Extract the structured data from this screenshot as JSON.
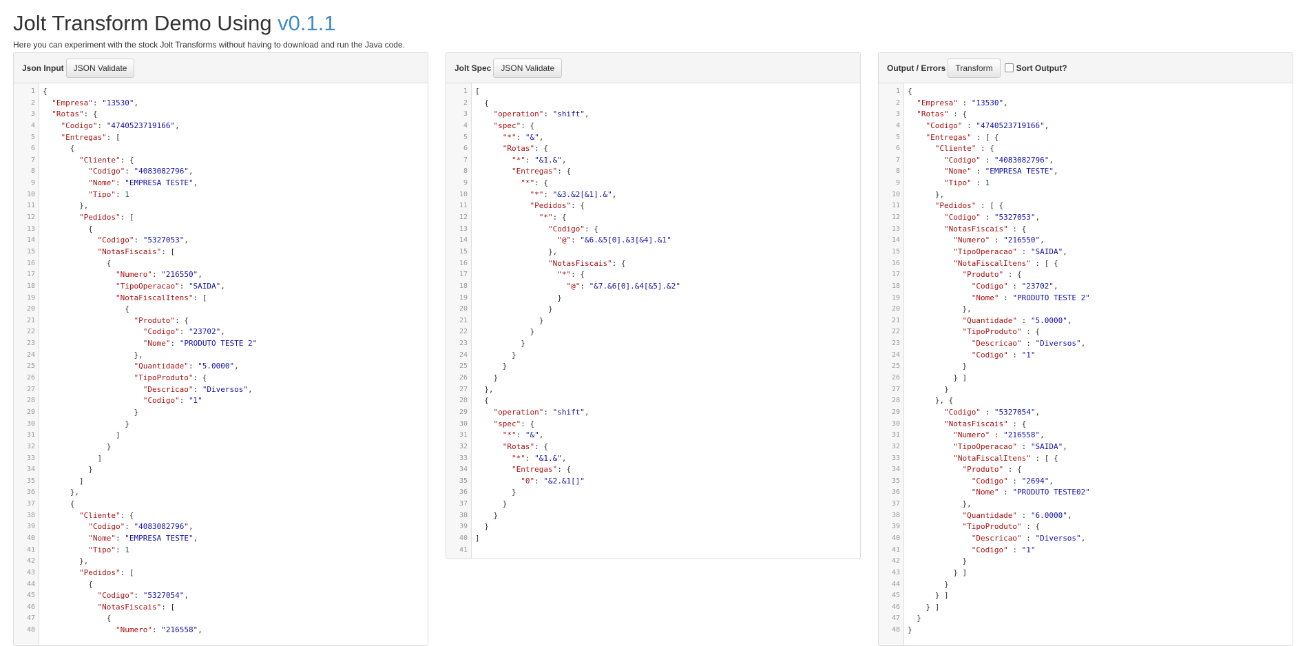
{
  "page": {
    "title": "Jolt Transform Demo Using ",
    "version": "v0.1.1",
    "subtitle": "Here you can experiment with the stock Jolt Transforms without having to download and run the Java code."
  },
  "panels": {
    "input": {
      "label": "Json Input",
      "validate": "JSON Validate"
    },
    "spec": {
      "label": "Jolt Spec",
      "validate": "JSON Validate"
    },
    "output": {
      "label": "Output / Errors",
      "transform": "Transform",
      "sort_label": "Sort Output?",
      "sort_checked": false
    }
  },
  "input_lines": [
    "{",
    "  \"Empresa\": \"13530\",",
    "  \"Rotas\": {",
    "    \"Codigo\": \"4740523719166\",",
    "    \"Entregas\": [",
    "      {",
    "        \"Cliente\": {",
    "          \"Codigo\": \"4083082796\",",
    "          \"Nome\": \"EMPRESA TESTE\",",
    "          \"Tipo\": 1",
    "        },",
    "        \"Pedidos\": [",
    "          {",
    "            \"Codigo\": \"5327053\",",
    "            \"NotasFiscais\": [",
    "              {",
    "                \"Numero\": \"216550\",",
    "                \"TipoOperacao\": \"SAIDA\",",
    "                \"NotaFiscalItens\": [",
    "                  {",
    "                    \"Produto\": {",
    "                      \"Codigo\": \"23702\",",
    "                      \"Nome\": \"PRODUTO TESTE 2\"",
    "                    },",
    "                    \"Quantidade\": \"5.0000\",",
    "                    \"TipoProduto\": {",
    "                      \"Descricao\": \"Diversos\",",
    "                      \"Codigo\": \"1\"",
    "                    }",
    "                  }",
    "                ]",
    "              }",
    "            ]",
    "          }",
    "        ]",
    "      },",
    "      {",
    "        \"Cliente\": {",
    "          \"Codigo\": \"4083082796\",",
    "          \"Nome\": \"EMPRESA TESTE\",",
    "          \"Tipo\": 1",
    "        },",
    "        \"Pedidos\": [",
    "          {",
    "            \"Codigo\": \"5327054\",",
    "            \"NotasFiscais\": [",
    "              {",
    "                \"Numero\": \"216558\","
  ],
  "spec_lines": [
    "[",
    "  {",
    "    \"operation\": \"shift\",",
    "    \"spec\": {",
    "      \"*\": \"&\",",
    "      \"Rotas\": {",
    "        \"*\": \"&1.&\",",
    "        \"Entregas\": {",
    "          \"*\": {",
    "            \"*\": \"&3.&2[&1].&\",",
    "            \"Pedidos\": {",
    "              \"*\": {",
    "                \"Codigo\": {",
    "                  \"@\": \"&6.&5[0].&3[&4].&1\"",
    "                },",
    "                \"NotasFiscais\": {",
    "                  \"*\": {",
    "                    \"@\": \"&7.&6[0].&4[&5].&2\"",
    "                  }",
    "                }",
    "              }",
    "            }",
    "          }",
    "        }",
    "      }",
    "    }",
    "  },",
    "  {",
    "    \"operation\": \"shift\",",
    "    \"spec\": {",
    "      \"*\": \"&\",",
    "      \"Rotas\": {",
    "        \"*\": \"&1.&\",",
    "        \"Entregas\": {",
    "          \"0\": \"&2.&1[]\"",
    "        }",
    "      }",
    "    }",
    "  }",
    "]",
    ""
  ],
  "output_lines": [
    "{",
    "  \"Empresa\" : \"13530\",",
    "  \"Rotas\" : {",
    "    \"Codigo\" : \"4740523719166\",",
    "    \"Entregas\" : [ {",
    "      \"Cliente\" : {",
    "        \"Codigo\" : \"4083082796\",",
    "        \"Nome\" : \"EMPRESA TESTE\",",
    "        \"Tipo\" : 1",
    "      },",
    "      \"Pedidos\" : [ {",
    "        \"Codigo\" : \"5327053\",",
    "        \"NotasFiscais\" : {",
    "          \"Numero\" : \"216550\",",
    "          \"TipoOperacao\" : \"SAIDA\",",
    "          \"NotaFiscalItens\" : [ {",
    "            \"Produto\" : {",
    "              \"Codigo\" : \"23702\",",
    "              \"Nome\" : \"PRODUTO TESTE 2\"",
    "            },",
    "            \"Quantidade\" : \"5.0000\",",
    "            \"TipoProduto\" : {",
    "              \"Descricao\" : \"Diversos\",",
    "              \"Codigo\" : \"1\"",
    "            }",
    "          } ]",
    "        }",
    "      }, {",
    "        \"Codigo\" : \"5327054\",",
    "        \"NotasFiscais\" : {",
    "          \"Numero\" : \"216558\",",
    "          \"TipoOperacao\" : \"SAIDA\",",
    "          \"NotaFiscalItens\" : [ {",
    "            \"Produto\" : {",
    "              \"Codigo\" : \"2694\",",
    "              \"Nome\" : \"PRODUTO TESTE02\"",
    "            },",
    "            \"Quantidade\" : \"6.0000\",",
    "            \"TipoProduto\" : {",
    "              \"Descricao\" : \"Diversos\",",
    "              \"Codigo\" : \"1\"",
    "            }",
    "          } ]",
    "        }",
    "      } ]",
    "    } ]",
    "  }",
    "}"
  ],
  "colors": {
    "key": "#aa1111",
    "string": "#1111aa",
    "number": "#116644",
    "accent": "#428bca"
  }
}
